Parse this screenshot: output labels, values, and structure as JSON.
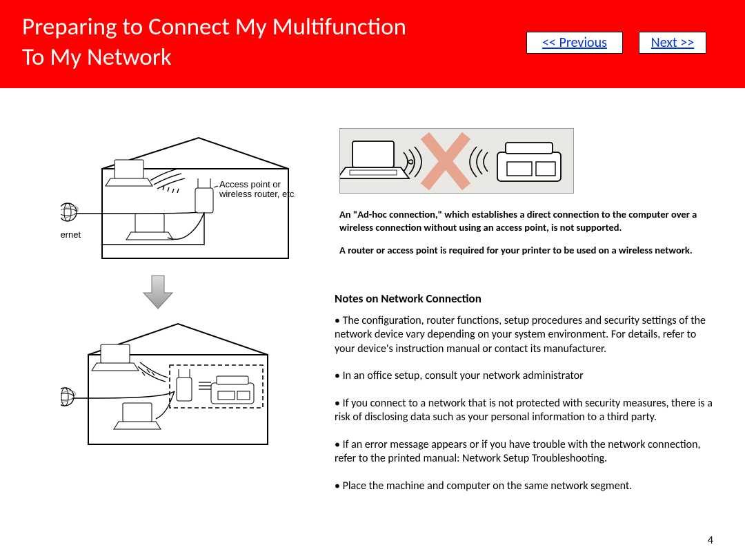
{
  "header": {
    "title_line1": "Preparing to Connect My Multifunction",
    "title_line2": "To My Network"
  },
  "nav": {
    "previous": "<< Previous",
    "next": "Next >>"
  },
  "diagram": {
    "internet_label": "Internet",
    "access_point_label": "Access point or\nwireless router, etc."
  },
  "adhoc": {
    "para1": "An \"Ad-hoc connection,\" which establishes a direct connection to the computer over a wireless connection without using an access point, is not supported.",
    "para2": "A router or  access point is required for your printer to be used on a wireless network."
  },
  "notes": {
    "heading": "Notes on Network Connection",
    "items": [
      "• The configuration, router functions, setup procedures and security settings of the network device vary depending on your system environment. For details, refer to your device's instruction manual or contact its manufacturer.",
      "• In an office setup, consult your network administrator",
      "• If you connect to a network that is not protected with security measures, there is a risk of disclosing data such as your personal information to a third party.",
      "• If an error message appears or if you have trouble with the network connection, refer to the printed manual: Network Setup Troubleshooting.",
      "• Place the machine and computer on the same network segment."
    ]
  },
  "page_number": "4"
}
